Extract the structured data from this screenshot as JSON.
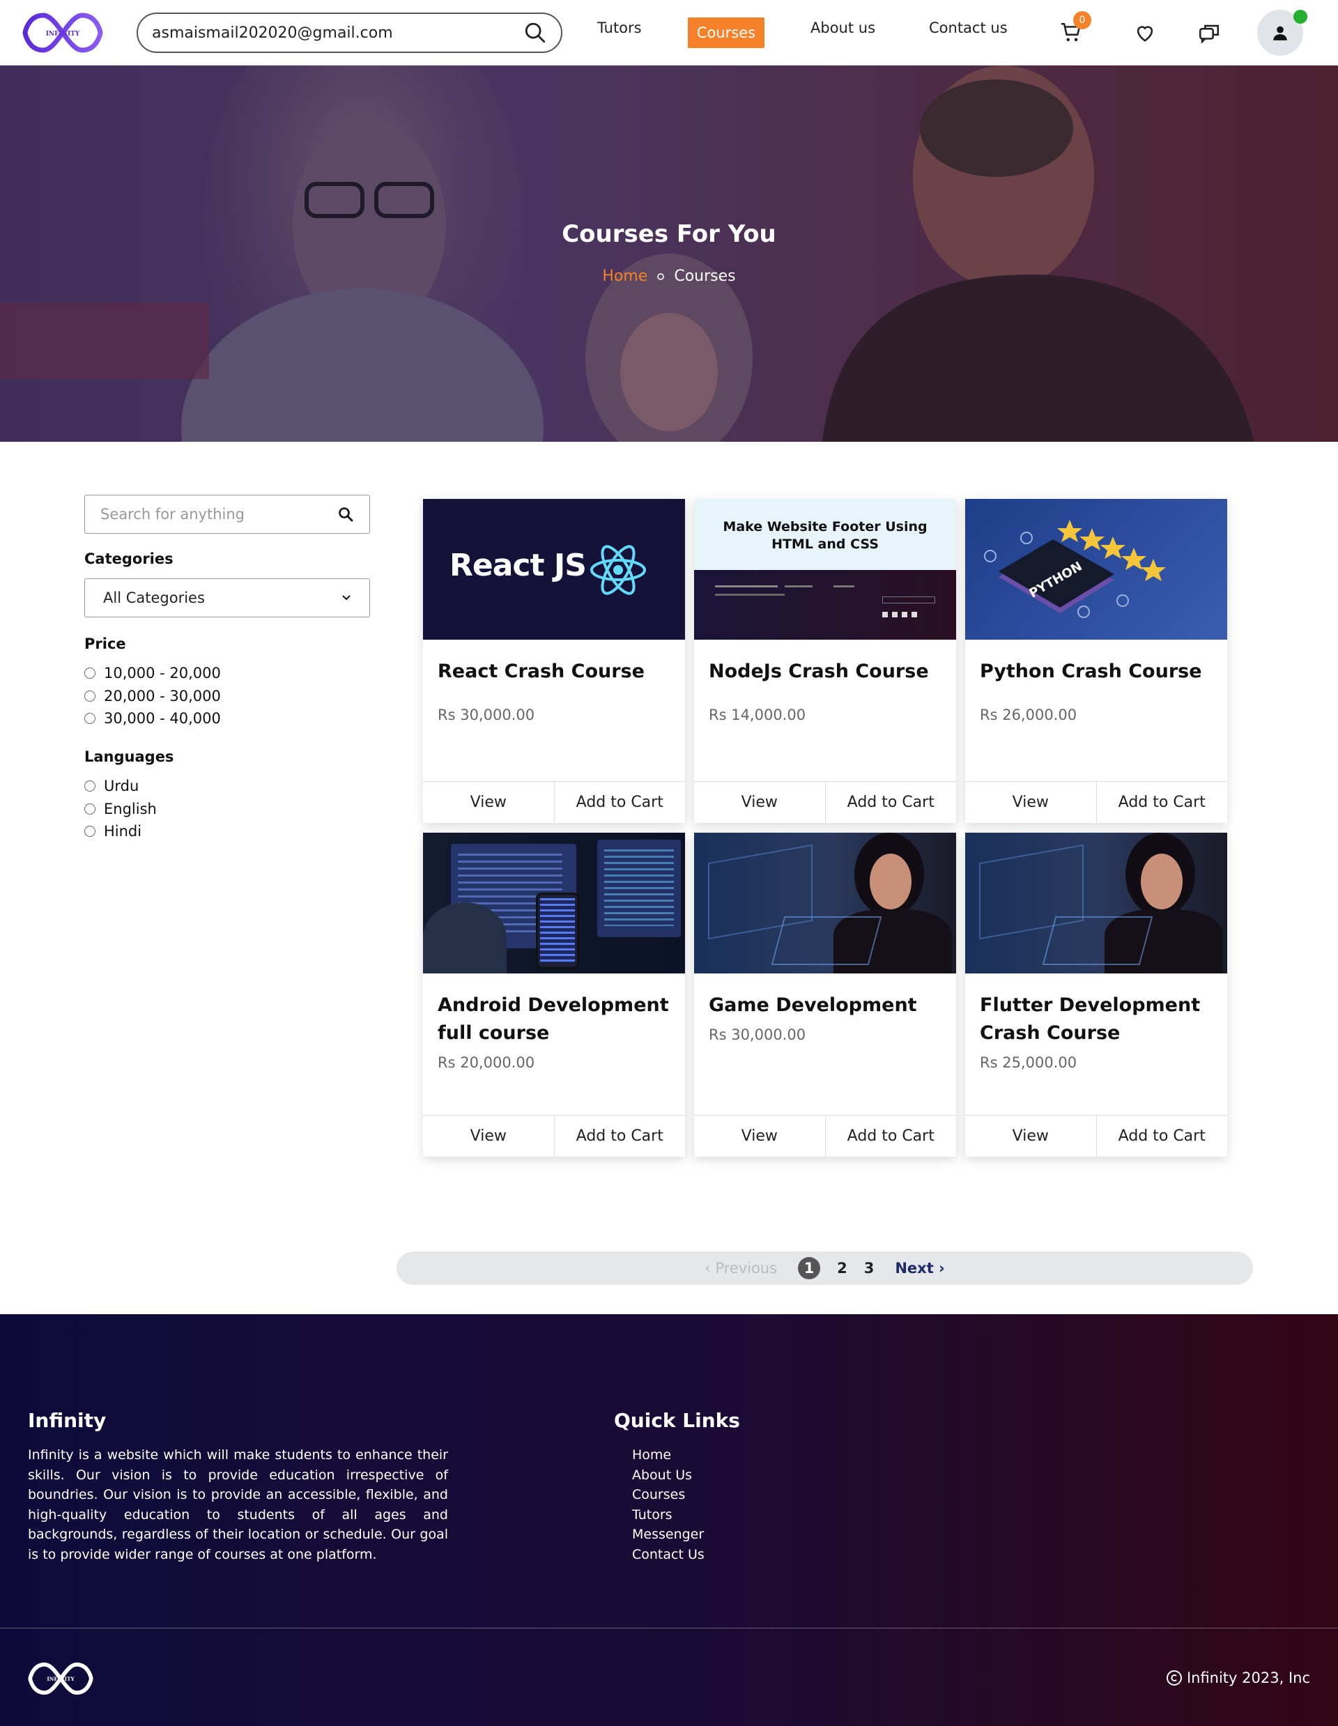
{
  "nav": {
    "logo_text": "INFINITY",
    "search_value": "asmaismail202020@gmail.com",
    "links": [
      {
        "label": "Tutors"
      },
      {
        "label": "Courses"
      },
      {
        "label": "About us"
      },
      {
        "label": "Contact us"
      }
    ],
    "cart_count": "0",
    "icons": [
      "search-icon",
      "cart-icon",
      "heart-icon",
      "chat-icon",
      "user-icon"
    ],
    "accent": "#f5822a",
    "online_color": "#22b02e"
  },
  "hero": {
    "title": "Courses For You",
    "breadcrumb_home": "Home",
    "breadcrumb_current": "Courses"
  },
  "sidebar": {
    "search_placeholder": "Search for anything",
    "categories_heading": "Categories",
    "category_selected": "All Categories",
    "price_heading": "Price",
    "price_options": [
      "10,000 - 20,000",
      "20,000 - 30,000",
      "30,000 - 40,000"
    ],
    "languages_heading": "Languages",
    "language_options": [
      "Urdu",
      "English",
      "Hindi"
    ]
  },
  "courses": [
    {
      "title": "React Crash Course",
      "price": "Rs 30,000.00",
      "thumb_text": "React JS"
    },
    {
      "title": "NodeJs Crash Course",
      "price": "Rs 14,000.00",
      "thumb_text": "Make Website Footer Using HTML and CSS"
    },
    {
      "title": "Python Crash Course",
      "price": "Rs 26,000.00",
      "thumb_text": "PYTHON"
    },
    {
      "title": "Android Development full course",
      "price": "Rs 20,000.00"
    },
    {
      "title": "Game Development",
      "price": "Rs 30,000.00"
    },
    {
      "title": "Flutter Development Crash Course",
      "price": "Rs 25,000.00"
    }
  ],
  "card_actions": {
    "view": "View",
    "add": "Add to Cart"
  },
  "pagination": {
    "prev": "‹ Previous",
    "pages": [
      "1",
      "2",
      "3"
    ],
    "current": "1",
    "next": "Next ›"
  },
  "footer": {
    "brand_title": "Infinity",
    "about": "Infinity is a website which will make students to enhance their skills. Our vision is to provide education irrespective of boundries. Our vision is to provide an accessible, flexible, and high-quality education to students of all ages and backgrounds, regardless of their location or schedule. Our goal is to provide wider range of courses at one platform.",
    "links_title": "Quick Links",
    "links": [
      "Home",
      "About Us",
      "Courses",
      "Tutors",
      "Messenger",
      "Contact Us"
    ],
    "copyright": "Infinity 2023, Inc",
    "logo_text": "INFINITY"
  }
}
